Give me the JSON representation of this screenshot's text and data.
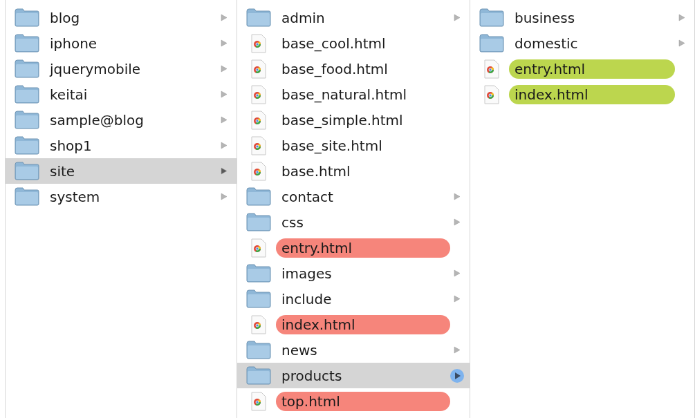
{
  "columns": [
    {
      "active": false,
      "items": [
        {
          "kind": "folder",
          "name": "blog",
          "selected": false
        },
        {
          "kind": "folder",
          "name": "iphone",
          "selected": false
        },
        {
          "kind": "folder",
          "name": "jquerymobile",
          "selected": false
        },
        {
          "kind": "folder",
          "name": "keitai",
          "selected": false
        },
        {
          "kind": "folder",
          "name": "sample@blog",
          "selected": false
        },
        {
          "kind": "folder",
          "name": "shop1",
          "selected": false
        },
        {
          "kind": "folder",
          "name": "site",
          "selected": true
        },
        {
          "kind": "folder",
          "name": "system",
          "selected": false
        }
      ]
    },
    {
      "active": true,
      "items": [
        {
          "kind": "folder",
          "name": "admin",
          "selected": false
        },
        {
          "kind": "file",
          "name": "base_cool.html",
          "selected": false
        },
        {
          "kind": "file",
          "name": "base_food.html",
          "selected": false
        },
        {
          "kind": "file",
          "name": "base_natural.html",
          "selected": false
        },
        {
          "kind": "file",
          "name": "base_simple.html",
          "selected": false
        },
        {
          "kind": "file",
          "name": "base_site.html",
          "selected": false
        },
        {
          "kind": "file",
          "name": "base.html",
          "selected": false
        },
        {
          "kind": "folder",
          "name": "contact",
          "selected": false
        },
        {
          "kind": "folder",
          "name": "css",
          "selected": false
        },
        {
          "kind": "file",
          "name": "entry.html",
          "selected": false,
          "color": "#f6857b"
        },
        {
          "kind": "folder",
          "name": "images",
          "selected": false
        },
        {
          "kind": "folder",
          "name": "include",
          "selected": false
        },
        {
          "kind": "file",
          "name": "index.html",
          "selected": false,
          "color": "#f6857b"
        },
        {
          "kind": "folder",
          "name": "news",
          "selected": false
        },
        {
          "kind": "folder",
          "name": "products",
          "selected": true
        },
        {
          "kind": "file",
          "name": "top.html",
          "selected": false,
          "color": "#f6857b"
        }
      ]
    },
    {
      "items": [
        {
          "kind": "folder",
          "name": "business",
          "selected": false
        },
        {
          "kind": "folder",
          "name": "domestic",
          "selected": false
        },
        {
          "kind": "file",
          "name": "entry.html",
          "selected": false,
          "color": "#bcd64e"
        },
        {
          "kind": "file",
          "name": "index.html",
          "selected": false,
          "color": "#bcd64e"
        }
      ]
    }
  ]
}
